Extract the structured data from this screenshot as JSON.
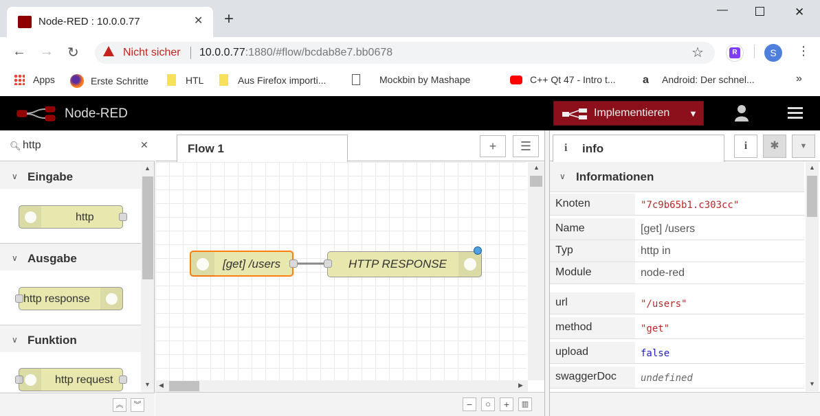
{
  "browser": {
    "tab_title": "Node-RED : 10.0.0.77",
    "security_label": "Nicht sicher",
    "url_host": "10.0.0.77",
    "url_rest": ":1880/#flow/bcdab8e7.bb0678",
    "profile_initial": "S",
    "extension_initial": "R",
    "bookmarks": [
      {
        "label": "Apps",
        "icon": "apps-grid-icon"
      },
      {
        "label": "Erste Schritte",
        "icon": "firefox-icon"
      },
      {
        "label": "HTL",
        "icon": "folder-icon"
      },
      {
        "label": "Aus Firefox importi...",
        "icon": "folder-icon"
      },
      {
        "label": "Mockbin by Mashape",
        "icon": "page-icon"
      },
      {
        "label": "C++ Qt 47 - Intro t...",
        "icon": "youtube-icon"
      },
      {
        "label": "Android: Der schnel...",
        "icon": "amazon-icon"
      }
    ],
    "overflow": "»"
  },
  "header": {
    "title": "Node-RED",
    "deploy_label": "Implementieren"
  },
  "palette": {
    "search_value": "http",
    "categories": [
      {
        "label": "Eingabe",
        "nodes": [
          "http"
        ]
      },
      {
        "label": "Ausgabe",
        "nodes": [
          "http response"
        ]
      },
      {
        "label": "Funktion",
        "nodes": [
          "http request"
        ]
      }
    ]
  },
  "workspace": {
    "tab_label": "Flow 1",
    "nodes": [
      {
        "label": "[get] /users",
        "selected": true
      },
      {
        "label": "HTTP RESPONSE",
        "selected": false
      }
    ]
  },
  "sidebar": {
    "tab_label": "info",
    "section_title": "Informationen",
    "rows": [
      {
        "key": "Knoten",
        "value": "\"7c9b65b1.c303cc\"",
        "kind": "str"
      },
      {
        "key": "Name",
        "value": "[get] /users",
        "kind": "plain"
      },
      {
        "key": "Typ",
        "value": "http in",
        "kind": "plain"
      },
      {
        "key": "Module",
        "value": "node-red",
        "kind": "plain"
      },
      {
        "key": "url",
        "value": "\"/users\"",
        "kind": "str"
      },
      {
        "key": "method",
        "value": "\"get\"",
        "kind": "str"
      },
      {
        "key": "upload",
        "value": "false",
        "kind": "bool"
      },
      {
        "key": "swaggerDoc",
        "value": "undefined",
        "kind": "undef"
      }
    ]
  },
  "colors": {
    "node_fill": "#e7e7ae",
    "deploy_red": "#8c101c",
    "selected_border": "#ff7f0e",
    "changed_dot": "#4fa0e0"
  }
}
